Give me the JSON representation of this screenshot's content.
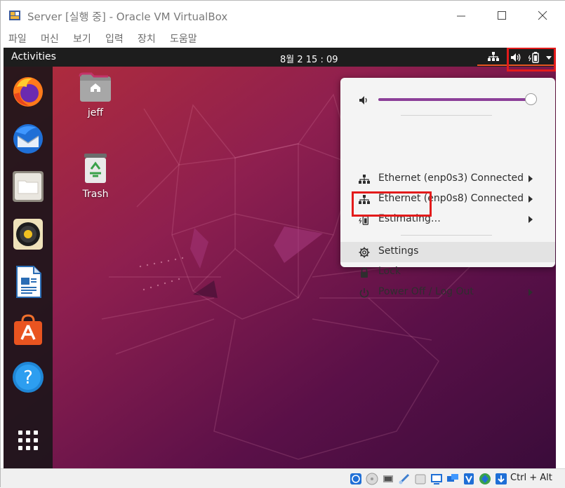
{
  "window": {
    "title": "Server [실행 중] - Oracle VM VirtualBox"
  },
  "menubar": {
    "items": [
      "파일",
      "머신",
      "보기",
      "입력",
      "장치",
      "도움말"
    ]
  },
  "guest": {
    "topbar": {
      "activities": "Activities",
      "clock": "8월 2  15 : 09"
    },
    "desktop_icons": [
      {
        "label": "jeff",
        "icon": "home-folder-icon"
      },
      {
        "label": "Trash",
        "icon": "trash-icon"
      }
    ],
    "dock": [
      {
        "name": "firefox",
        "icon": "firefox-icon"
      },
      {
        "name": "thunderbird",
        "icon": "thunderbird-icon"
      },
      {
        "name": "files",
        "icon": "files-icon"
      },
      {
        "name": "rhythmbox",
        "icon": "rhythmbox-icon"
      },
      {
        "name": "writer",
        "icon": "writer-icon"
      },
      {
        "name": "software",
        "icon": "software-icon"
      },
      {
        "name": "help",
        "icon": "help-icon"
      },
      {
        "name": "show-applications",
        "icon": "grid-icon"
      }
    ],
    "system_menu": {
      "volume_level": 1.0,
      "items": {
        "ethernet1": "Ethernet (enp0s3) Connected",
        "ethernet2": "Ethernet (enp0s8) Connected",
        "battery": "Estimating…",
        "settings": "Settings",
        "lock": "Lock",
        "power": "Power Off / Log Out"
      }
    }
  },
  "statusbar": {
    "host_key": "Ctrl + Alt"
  },
  "colors": {
    "accent": "#e95420",
    "highlight_box": "#e31b1b",
    "slider": "#8b3f98"
  }
}
